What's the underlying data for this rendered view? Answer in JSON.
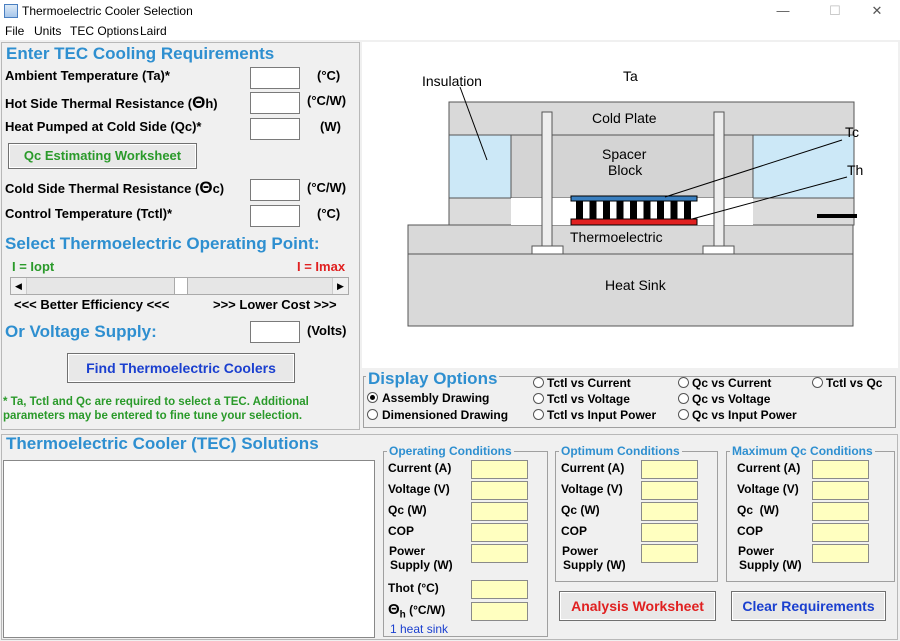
{
  "window": {
    "title": "Thermoelectric Cooler Selection",
    "minimize": "—",
    "maximize": "☐",
    "close": "✕"
  },
  "menu": [
    "File",
    "Units",
    "TEC Options",
    "Laird"
  ],
  "requirements": {
    "heading": "Enter TEC Cooling Requirements",
    "ambient_label": "Ambient Temperature (Ta)*",
    "ambient_unit": "(°C)",
    "hot_res_label": "Hot Side Thermal Resistance (",
    "hot_res_theta": "Θ",
    "hot_res_sub": "h)",
    "hot_res_unit": "(°C/W)",
    "heat_label": "Heat Pumped at Cold Side (Qc)*",
    "heat_unit": "(W)",
    "worksheet_btn": "Qc Estimating Worksheet",
    "cold_res_label": "Cold Side Thermal Resistance (",
    "cold_res_theta": "Θ",
    "cold_res_sub": "c)",
    "cold_res_unit": "(°C/W)",
    "control_label": "Control Temperature (Tctl)*",
    "control_unit": "(°C)"
  },
  "operating_point": {
    "heading": "Select Thermoelectric Operating Point:",
    "left_label": "I = Iopt",
    "right_label": "I = Imax",
    "left_caption": "<<< Better Efficiency <<<",
    "right_caption": ">>> Lower Cost >>>",
    "slider_position": 0.5
  },
  "voltage": {
    "heading": "Or Voltage Supply:",
    "unit": "(Volts)"
  },
  "find_btn": "Find Thermoelectric Coolers",
  "note": "* Ta, Tctl and Qc are required to select a TEC. Additional parameters may be entered to fine tune your selection.",
  "drawing": {
    "insulation": "Insulation",
    "ta": "Ta",
    "cold_plate": "Cold Plate",
    "spacer": "Spacer",
    "block": "Block",
    "tc": "Tc",
    "th": "Th",
    "thermoelectric": "Thermoelectric",
    "heat_sink": "Heat Sink"
  },
  "display_options": {
    "heading": "Display Options",
    "left": [
      {
        "label": "Assembly Drawing",
        "checked": true
      },
      {
        "label": "Dimensioned Drawing",
        "checked": false
      }
    ],
    "col1": [
      "Tctl vs Current",
      "Tctl vs Voltage",
      "Tctl vs Input Power"
    ],
    "col2": [
      "Qc vs Current",
      "Qc vs Voltage",
      "Qc vs Input Power"
    ],
    "col3": [
      "Tctl vs Qc"
    ]
  },
  "solutions": {
    "heading": "Thermoelectric Cooler (TEC) Solutions"
  },
  "operating": {
    "title": "Operating Conditions",
    "current": "Current (A)",
    "voltage": "Voltage (V)",
    "qc": "Qc (W)",
    "cop": "COP",
    "power1": "Power",
    "power2": "Supply (W)",
    "thot": "Thot (°C)",
    "theta": "Θ",
    "theta_sub": "h",
    "theta_unit": "(°C/W)",
    "heat_sink": "1 heat sink"
  },
  "optimum": {
    "title": "Optimum Conditions",
    "current": "Current (A)",
    "voltage": "Voltage (V)",
    "qc": "Qc (W)",
    "cop": "COP",
    "power1": "Power",
    "power2": "Supply (W)"
  },
  "maximum": {
    "title": "Maximum Qc Conditions",
    "current": "Current (A)",
    "voltage": "Voltage (V)",
    "qc": "Qc  (W)",
    "cop": "COP",
    "power1": "Power",
    "power2": "Supply (W)"
  },
  "analysis_btn": "Analysis Worksheet",
  "clear_btn": "Clear Requirements",
  "colors": {
    "accent": "#2e8fd0",
    "iopt": "#2a9a2a",
    "imax": "#e02020",
    "analysis": "#e02020",
    "clear": "#1a3fcf",
    "note": "#2a9a2a",
    "highlight": "#ffffc0"
  }
}
